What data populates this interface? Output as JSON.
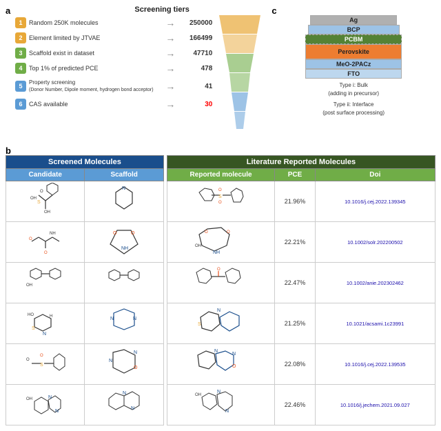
{
  "panels": {
    "a_label": "a",
    "b_label": "b",
    "c_label": "c"
  },
  "screening": {
    "title": "Screening tiers",
    "tiers": [
      {
        "num": "1",
        "desc": "Random 250K molecules",
        "count": "250000",
        "color": "#e8a838"
      },
      {
        "num": "2",
        "desc": "Element limited by JTVAE",
        "count": "166499",
        "color": "#e8a838"
      },
      {
        "num": "3",
        "desc": "Scaffold exist in dataset",
        "count": "47710",
        "color": "#70ad47"
      },
      {
        "num": "4",
        "desc": "Top 1% of predicted PCE",
        "count": "478",
        "color": "#70ad47"
      },
      {
        "num": "5",
        "desc": "Property screening\n(Donor Number, Dipole moment, hydrogen bond acceptor)",
        "count": "41",
        "color": "#5b9bd5"
      },
      {
        "num": "6",
        "desc": "CAS available",
        "count": "30",
        "color": "#5b9bd5",
        "red": true
      }
    ]
  },
  "device": {
    "layers": [
      {
        "label": "Ag",
        "color": "#c0c0c0"
      },
      {
        "label": "BCP",
        "color": "#9dc3e6"
      },
      {
        "label": "PCBM",
        "color": "#548235",
        "dashed": true
      },
      {
        "label": "Perovskite",
        "color": "#ed7d31"
      },
      {
        "label": "MeO-2PACz",
        "color": "#9dc3e6"
      },
      {
        "label": "FTO",
        "color": "#bdd7ee"
      }
    ],
    "type_i": "Type i: Bulk\n(adding in precursor)",
    "type_ii": "Type ii: Interface\n(post surface processing)"
  },
  "screened_molecules": {
    "header": "Screened Molecules",
    "col1": "Candidate",
    "col2": "Scaffold"
  },
  "literature": {
    "header": "Literature Reported Molecules",
    "col1": "Reported molecule",
    "col2": "PCE",
    "col3": "Doi",
    "rows": [
      {
        "pce": "21.96%",
        "doi": "10.1016/j.cej.2022.139345"
      },
      {
        "pce": "22.21%",
        "doi": "10.1002/solr.202200502"
      },
      {
        "pce": "22.47%",
        "doi": "10.1002/anie.202302462"
      },
      {
        "pce": "21.25%",
        "doi": "10.1021/acsami.1c23991"
      },
      {
        "pce": "22.08%",
        "doi": "10.1016/j.cej.2022.139535"
      },
      {
        "pce": "22.46%",
        "doi": "10.1016/j.jechem.2021.09.027"
      }
    ]
  }
}
